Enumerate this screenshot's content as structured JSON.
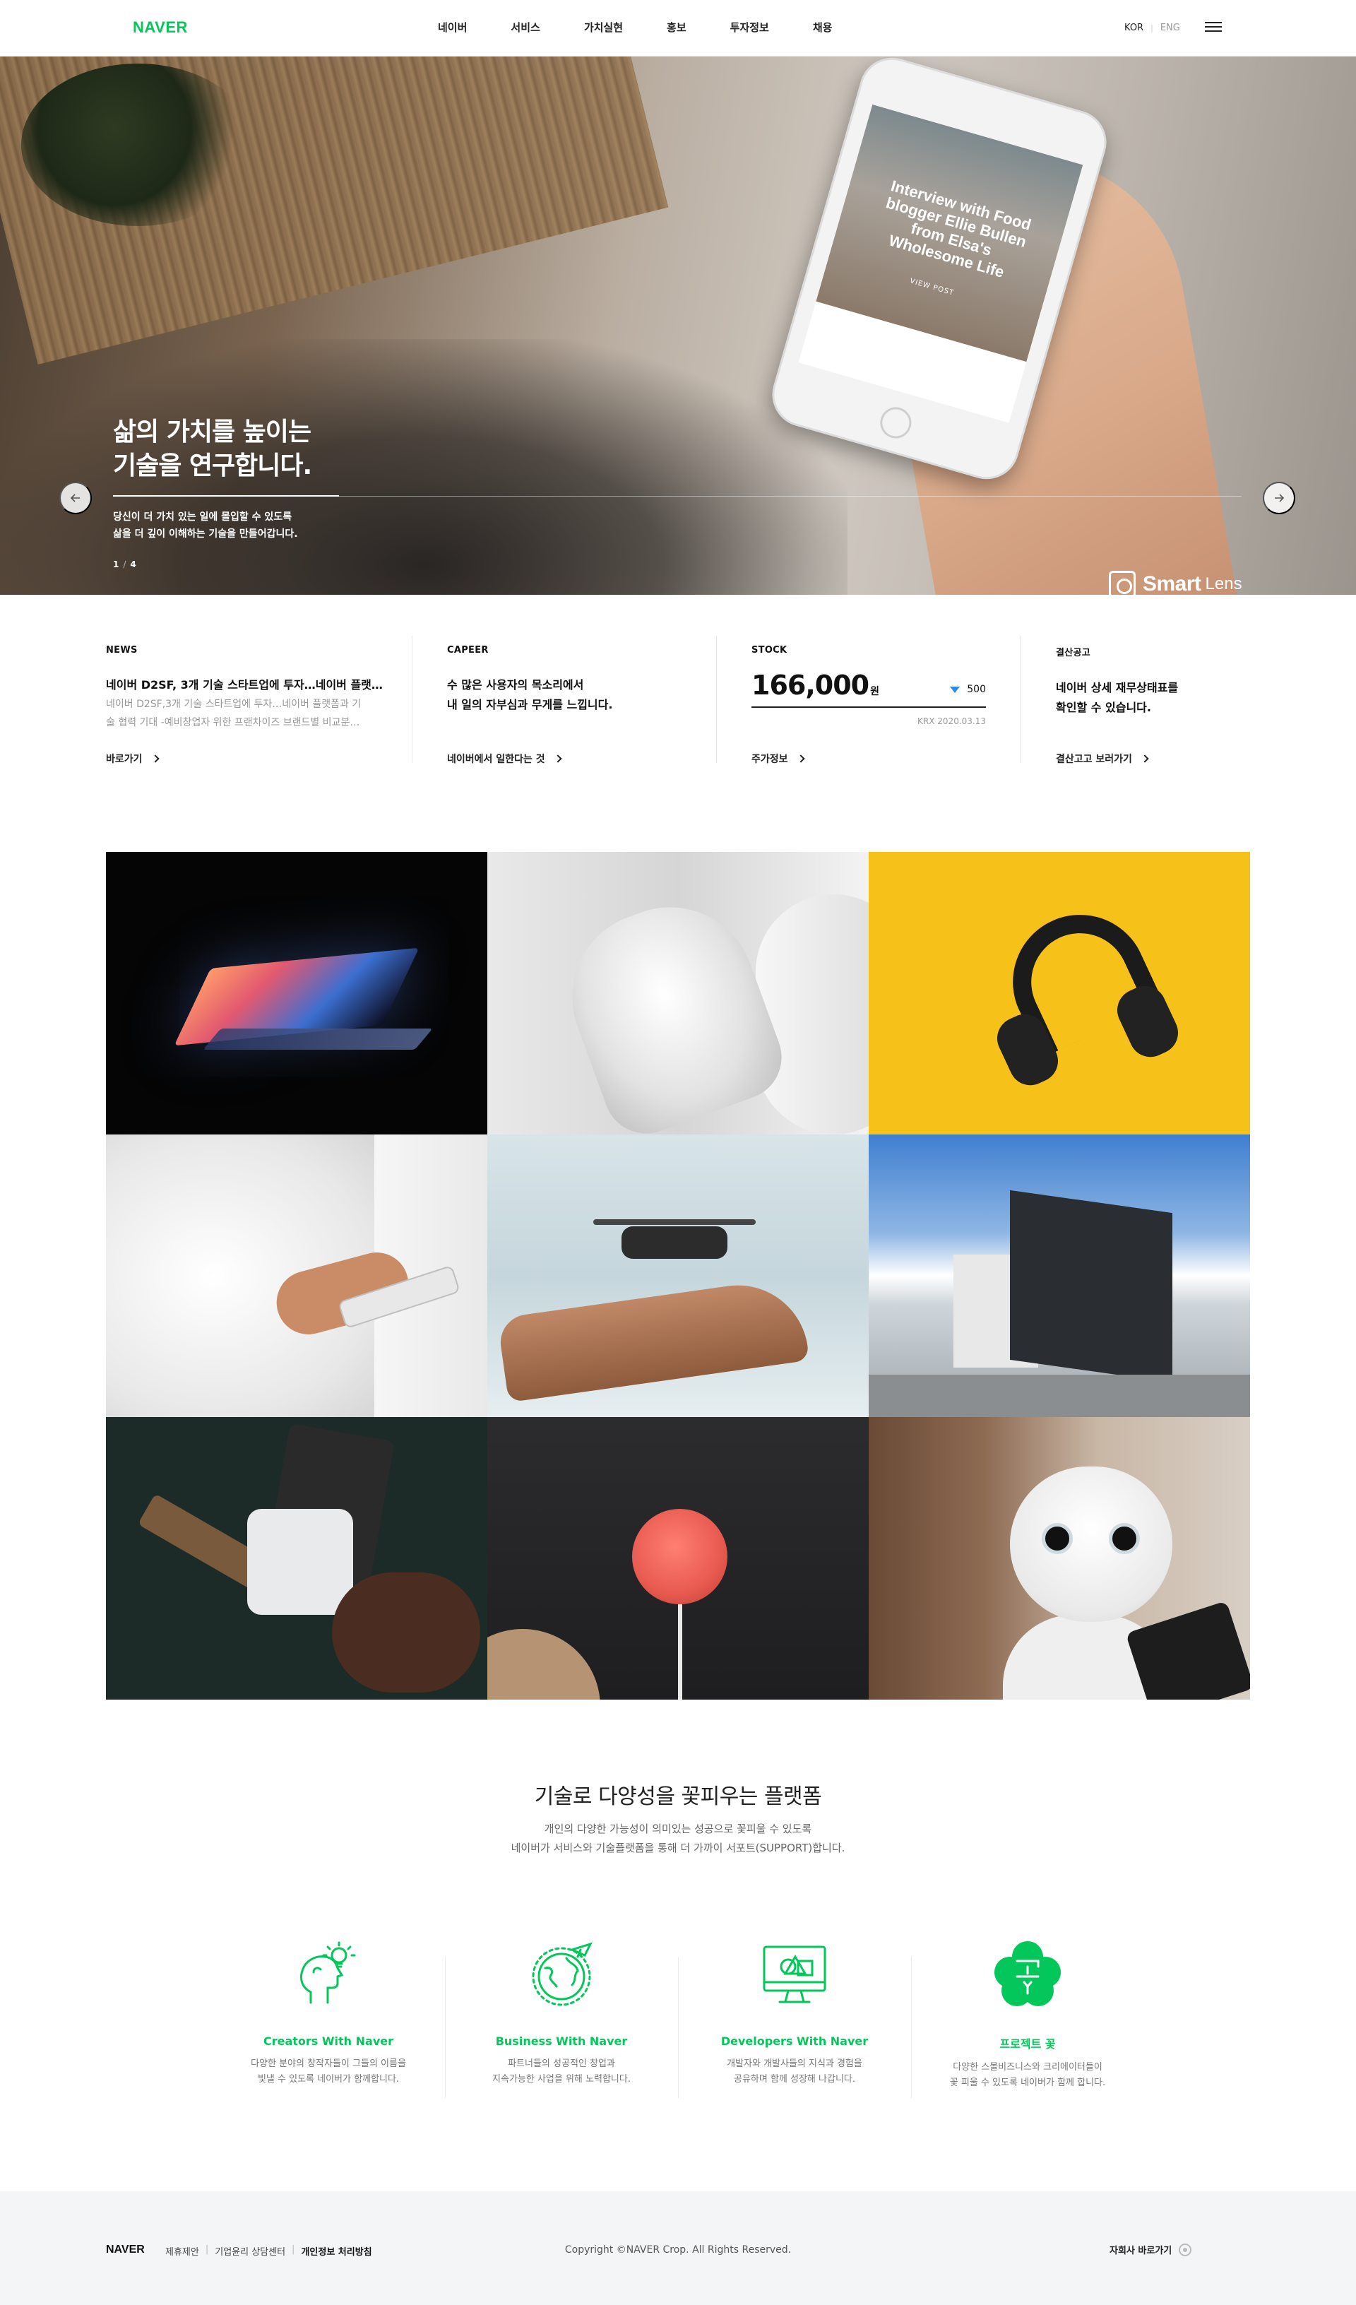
{
  "header": {
    "logo": "NAVER",
    "nav": [
      "네이버",
      "서비스",
      "가치실현",
      "홍보",
      "투자정보",
      "채용"
    ],
    "lang": {
      "kor": "KOR",
      "sep": "|",
      "eng": "ENG"
    },
    "menu_icon": "hamburger-menu-icon"
  },
  "hero": {
    "title_line1": "삶의 가치를 높이는",
    "title_line2": "기술을 연구합니다.",
    "desc_line1": "당신이 더 가치 있는 일에 몰입할 수 있도록",
    "desc_line2": "삶을 더 깊이 이해하는 기술을 만들어갑니다.",
    "page_current": "1",
    "page_sep": "/",
    "page_total": "4",
    "prev_icon": "arrow-left-icon",
    "next_icon": "arrow-right-icon",
    "brand_name": "Smart",
    "brand_sub": "Lens",
    "phone_screen_text": "Interview with Food blogger Ellie Bullen from Elsa's Wholesome Life",
    "phone_screen_button": "VIEW POST"
  },
  "info": {
    "news": {
      "label": "NEWS",
      "headline": "네이버 D2SF, 3개 기술 스타트업에 투자…네이버 플랫…",
      "body_line1": "네이버 D2SF,3개 기술 스타트업에 투자…네이버 플랫폼과 기",
      "body_line2": "술 협력 기대 -예비창업자 위한 프랜차이즈 브랜드별 비교분…",
      "link": "바로가기"
    },
    "career": {
      "label": "CAPEER",
      "headline_line1": "수 많은 사용자의 목소리에서",
      "headline_line2": "내 일의 자부심과 무게를 느낍니다.",
      "link": "네이버에서 일한다는 것"
    },
    "stock": {
      "label": "STOCK",
      "price": "166,000",
      "unit": "원",
      "change": "500",
      "change_direction": "down",
      "date": "KRX 2020.03.13",
      "link": "주가정보"
    },
    "settlement": {
      "label": "결산공고",
      "headline_line1": "네이버 상세 재무상태표를",
      "headline_line2": "확인할 수 있습니다.",
      "link": "결산고고 보러가기"
    }
  },
  "gallery": {
    "tiles": [
      "laptop-glow",
      "robot-hand",
      "headphones",
      "phone-hand",
      "drone",
      "naver-green-factory",
      "card-reader",
      "smart-speaker",
      "pepper-robot"
    ]
  },
  "platform": {
    "title": "기술로 다양성을 꽃피우는 플랫폼",
    "desc_line1": "개인의 다양한 가능성이 의미있는 성공으로 꽃피울 수 있도록",
    "desc_line2": "네이버가 서비스와 기술플랫폼을 통해 더 가까이 서포트(SUPPORT)합니다.",
    "services": [
      {
        "icon": "creator-idea-icon",
        "title": "Creators With Naver",
        "desc_line1": "다양한 분야의 창작자들이 그들의 이름을",
        "desc_line2": "빛낼 수 있도록 네이버가 함께합니다."
      },
      {
        "icon": "globe-plane-icon",
        "title": "Business With Naver",
        "desc_line1": "파트너들의 성공적인 창업과",
        "desc_line2": "지속가능한 사업을 위해 노력합니다."
      },
      {
        "icon": "monitor-people-icon",
        "title": "Developers With Naver",
        "desc_line1": "개발자와 개발사들의 지식과 경험을",
        "desc_line2": "공유하며 함께 성장해 나갑니다."
      },
      {
        "icon": "project-flower-icon",
        "title": "프로젝트 꽃",
        "desc_line1": "다양한 스몰비즈니스와 크리에이터들이",
        "desc_line2": "꽃 피울 수 있도록 네이버가 함께 합니다."
      }
    ],
    "accent_color": "#03c75a"
  },
  "footer": {
    "logo": "NAVER",
    "links": [
      "제휴제안",
      "기업윤리 상담센터",
      "개인정보 처리방침"
    ],
    "link_sep": "|",
    "copyright": "Copyright ©NAVER Crop. All Rights Reserved.",
    "family_site": "자회사 바로가기"
  }
}
